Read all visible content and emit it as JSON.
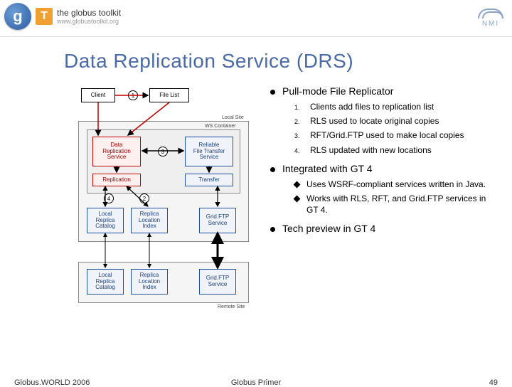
{
  "header": {
    "toolkit_text": "the globus toolkit",
    "url": "www.globustoolkit.org",
    "nmi": "NMI"
  },
  "title": "Data Replication Service (DRS)",
  "diagram": {
    "client": "Client",
    "file_list": "File List",
    "local_site": "Local Site",
    "ws_container": "WS Container",
    "drs": "Data\nReplication\nService",
    "rft": "Reliable\nFile Transfer\nService",
    "replication": "Replication",
    "transfer": "Transfer",
    "lrc": "Local\nReplica\nCatalog",
    "rli": "Replica\nLocation\nIndex",
    "gridftp": "Grid.FTP\nService",
    "remote_site": "Remote Site",
    "lrc2": "Local\nReplica\nCatalog",
    "rli2": "Replica\nLocation\nIndex",
    "gridftp2": "Grid.FTP\nService",
    "n1": "1",
    "n2": "2",
    "n3": "3",
    "n4": "4"
  },
  "bullets": {
    "b1_head": "Pull-mode File Replicator",
    "b1_items": [
      "Clients add files to replication list",
      "RLS used to locate original copies",
      "RFT/Grid.FTP used to make local copies",
      "RLS updated with new locations"
    ],
    "b2_head": "Integrated with GT 4",
    "b2_items": [
      "Uses WSRF-compliant services written in Java.",
      "Works with RLS, RFT, and Grid.FTP services in GT 4."
    ],
    "b3_head": "Tech preview in GT 4"
  },
  "footer": {
    "left": "Globus.WORLD 2006",
    "center": "Globus Primer",
    "right": "49"
  }
}
